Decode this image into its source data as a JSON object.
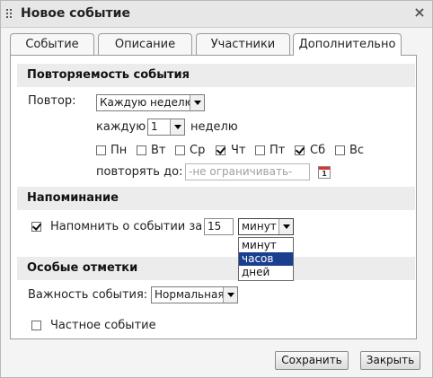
{
  "dialog": {
    "title": "Новое событие",
    "close_glyph": "×"
  },
  "tabs": [
    {
      "label": "Событие",
      "active": false
    },
    {
      "label": "Описание",
      "active": false
    },
    {
      "label": "Участники",
      "active": false
    },
    {
      "label": "Дополнительно",
      "active": true
    }
  ],
  "recurrence": {
    "heading": "Повторяемость события",
    "repeat_label": "Повтор:",
    "repeat_value": "Каждую неделю",
    "every_label": "каждую",
    "every_value": "1",
    "every_unit": "неделю",
    "days": [
      {
        "label": "Пн",
        "checked": false
      },
      {
        "label": "Вт",
        "checked": false
      },
      {
        "label": "Ср",
        "checked": false
      },
      {
        "label": "Чт",
        "checked": true
      },
      {
        "label": "Пт",
        "checked": false
      },
      {
        "label": "Сб",
        "checked": true
      },
      {
        "label": "Вс",
        "checked": false
      }
    ],
    "until_label": "повторять до:",
    "until_placeholder": "-не ограничивать-",
    "calendar_icon_text": "1"
  },
  "reminder": {
    "heading": "Напоминание",
    "enabled": true,
    "label": "Напомнить о событии за",
    "amount": "15",
    "unit_value": "минут",
    "unit_options": [
      {
        "label": "минут",
        "selected": false
      },
      {
        "label": "часов",
        "selected": true
      },
      {
        "label": "дней",
        "selected": false
      }
    ]
  },
  "special": {
    "heading": "Особые отметки",
    "importance_label": "Важность события:",
    "importance_value": "Нормальная",
    "private_label": "Частное событие",
    "private_checked": false
  },
  "buttons": {
    "save": "Сохранить",
    "close": "Закрыть"
  },
  "colors": {
    "selection": "#1a3f8f",
    "section_bg": "#ececec",
    "calendar_accent": "#dd3333"
  },
  "icons": [
    "drag-grip-icon",
    "close-icon",
    "calendar-icon",
    "dropdown-arrow-icon",
    "checkbox-icon"
  ]
}
